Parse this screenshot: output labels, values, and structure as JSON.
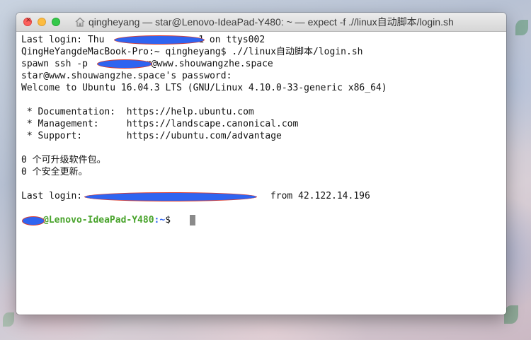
{
  "window": {
    "title": "qingheyang — star@Lenovo-IdeaPad-Y480: ~ — expect -f .//linux自动脚本/login.sh",
    "buttons": {
      "close": "close",
      "minimize": "minimize",
      "zoom": "zoom"
    },
    "title_icon": "home-icon"
  },
  "terminal": {
    "lines": [
      {
        "prefix": "Last login: Thu ",
        "suffix": "1 on ttys002"
      },
      {
        "text": "QingHeYangdeMacBook-Pro:~ qingheyang$ .//linux自动脚本/login.sh"
      },
      {
        "prefix": "spawn ssh -p ",
        "suffix": "r@www.shouwangzhe.space"
      },
      {
        "text": "star@www.shouwangzhe.space's password:"
      },
      {
        "text": "Welcome to Ubuntu 16.04.3 LTS (GNU/Linux 4.10.0-33-generic x86_64)"
      },
      {
        "text": ""
      },
      {
        "text": " * Documentation:  https://help.ubuntu.com"
      },
      {
        "text": " * Management:     https://landscape.canonical.com"
      },
      {
        "text": " * Support:        https://ubuntu.com/advantage"
      },
      {
        "text": ""
      },
      {
        "text": "0 个可升级软件包。"
      },
      {
        "text": "0 个安全更新。"
      },
      {
        "text": ""
      },
      {
        "prefix": "Last login: ",
        "suffix": "from 42.122.14.196"
      },
      {
        "host": "@Lenovo-IdeaPad-Y480",
        "path": ":~",
        "symbol": "$ "
      }
    ]
  },
  "colors": {
    "prompt_host": "#48a32b",
    "prompt_path": "#2f64f0",
    "redaction_fill": "#2f64f0",
    "redaction_outline": "#d93a2e"
  }
}
